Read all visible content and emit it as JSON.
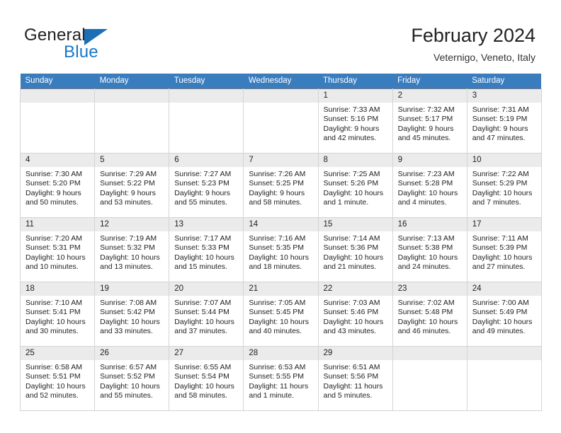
{
  "brand": {
    "name_part1": "General",
    "name_part2": "Blue",
    "accent_color": "#1878c8",
    "triangle_color": "#1c6fb5"
  },
  "header": {
    "title": "February 2024",
    "subtitle": "Veternigo, Veneto, Italy"
  },
  "calendar": {
    "header_bg": "#3a7dbf",
    "daynum_bg": "#ebebeb",
    "weekday_names": [
      "Sunday",
      "Monday",
      "Tuesday",
      "Wednesday",
      "Thursday",
      "Friday",
      "Saturday"
    ],
    "weeks": [
      [
        {
          "day": "",
          "sunrise": "",
          "sunset": "",
          "daylight": ""
        },
        {
          "day": "",
          "sunrise": "",
          "sunset": "",
          "daylight": ""
        },
        {
          "day": "",
          "sunrise": "",
          "sunset": "",
          "daylight": ""
        },
        {
          "day": "",
          "sunrise": "",
          "sunset": "",
          "daylight": ""
        },
        {
          "day": "1",
          "sunrise": "Sunrise: 7:33 AM",
          "sunset": "Sunset: 5:16 PM",
          "daylight": "Daylight: 9 hours and 42 minutes."
        },
        {
          "day": "2",
          "sunrise": "Sunrise: 7:32 AM",
          "sunset": "Sunset: 5:17 PM",
          "daylight": "Daylight: 9 hours and 45 minutes."
        },
        {
          "day": "3",
          "sunrise": "Sunrise: 7:31 AM",
          "sunset": "Sunset: 5:19 PM",
          "daylight": "Daylight: 9 hours and 47 minutes."
        }
      ],
      [
        {
          "day": "4",
          "sunrise": "Sunrise: 7:30 AM",
          "sunset": "Sunset: 5:20 PM",
          "daylight": "Daylight: 9 hours and 50 minutes."
        },
        {
          "day": "5",
          "sunrise": "Sunrise: 7:29 AM",
          "sunset": "Sunset: 5:22 PM",
          "daylight": "Daylight: 9 hours and 53 minutes."
        },
        {
          "day": "6",
          "sunrise": "Sunrise: 7:27 AM",
          "sunset": "Sunset: 5:23 PM",
          "daylight": "Daylight: 9 hours and 55 minutes."
        },
        {
          "day": "7",
          "sunrise": "Sunrise: 7:26 AM",
          "sunset": "Sunset: 5:25 PM",
          "daylight": "Daylight: 9 hours and 58 minutes."
        },
        {
          "day": "8",
          "sunrise": "Sunrise: 7:25 AM",
          "sunset": "Sunset: 5:26 PM",
          "daylight": "Daylight: 10 hours and 1 minute."
        },
        {
          "day": "9",
          "sunrise": "Sunrise: 7:23 AM",
          "sunset": "Sunset: 5:28 PM",
          "daylight": "Daylight: 10 hours and 4 minutes."
        },
        {
          "day": "10",
          "sunrise": "Sunrise: 7:22 AM",
          "sunset": "Sunset: 5:29 PM",
          "daylight": "Daylight: 10 hours and 7 minutes."
        }
      ],
      [
        {
          "day": "11",
          "sunrise": "Sunrise: 7:20 AM",
          "sunset": "Sunset: 5:31 PM",
          "daylight": "Daylight: 10 hours and 10 minutes."
        },
        {
          "day": "12",
          "sunrise": "Sunrise: 7:19 AM",
          "sunset": "Sunset: 5:32 PM",
          "daylight": "Daylight: 10 hours and 13 minutes."
        },
        {
          "day": "13",
          "sunrise": "Sunrise: 7:17 AM",
          "sunset": "Sunset: 5:33 PM",
          "daylight": "Daylight: 10 hours and 15 minutes."
        },
        {
          "day": "14",
          "sunrise": "Sunrise: 7:16 AM",
          "sunset": "Sunset: 5:35 PM",
          "daylight": "Daylight: 10 hours and 18 minutes."
        },
        {
          "day": "15",
          "sunrise": "Sunrise: 7:14 AM",
          "sunset": "Sunset: 5:36 PM",
          "daylight": "Daylight: 10 hours and 21 minutes."
        },
        {
          "day": "16",
          "sunrise": "Sunrise: 7:13 AM",
          "sunset": "Sunset: 5:38 PM",
          "daylight": "Daylight: 10 hours and 24 minutes."
        },
        {
          "day": "17",
          "sunrise": "Sunrise: 7:11 AM",
          "sunset": "Sunset: 5:39 PM",
          "daylight": "Daylight: 10 hours and 27 minutes."
        }
      ],
      [
        {
          "day": "18",
          "sunrise": "Sunrise: 7:10 AM",
          "sunset": "Sunset: 5:41 PM",
          "daylight": "Daylight: 10 hours and 30 minutes."
        },
        {
          "day": "19",
          "sunrise": "Sunrise: 7:08 AM",
          "sunset": "Sunset: 5:42 PM",
          "daylight": "Daylight: 10 hours and 33 minutes."
        },
        {
          "day": "20",
          "sunrise": "Sunrise: 7:07 AM",
          "sunset": "Sunset: 5:44 PM",
          "daylight": "Daylight: 10 hours and 37 minutes."
        },
        {
          "day": "21",
          "sunrise": "Sunrise: 7:05 AM",
          "sunset": "Sunset: 5:45 PM",
          "daylight": "Daylight: 10 hours and 40 minutes."
        },
        {
          "day": "22",
          "sunrise": "Sunrise: 7:03 AM",
          "sunset": "Sunset: 5:46 PM",
          "daylight": "Daylight: 10 hours and 43 minutes."
        },
        {
          "day": "23",
          "sunrise": "Sunrise: 7:02 AM",
          "sunset": "Sunset: 5:48 PM",
          "daylight": "Daylight: 10 hours and 46 minutes."
        },
        {
          "day": "24",
          "sunrise": "Sunrise: 7:00 AM",
          "sunset": "Sunset: 5:49 PM",
          "daylight": "Daylight: 10 hours and 49 minutes."
        }
      ],
      [
        {
          "day": "25",
          "sunrise": "Sunrise: 6:58 AM",
          "sunset": "Sunset: 5:51 PM",
          "daylight": "Daylight: 10 hours and 52 minutes."
        },
        {
          "day": "26",
          "sunrise": "Sunrise: 6:57 AM",
          "sunset": "Sunset: 5:52 PM",
          "daylight": "Daylight: 10 hours and 55 minutes."
        },
        {
          "day": "27",
          "sunrise": "Sunrise: 6:55 AM",
          "sunset": "Sunset: 5:54 PM",
          "daylight": "Daylight: 10 hours and 58 minutes."
        },
        {
          "day": "28",
          "sunrise": "Sunrise: 6:53 AM",
          "sunset": "Sunset: 5:55 PM",
          "daylight": "Daylight: 11 hours and 1 minute."
        },
        {
          "day": "29",
          "sunrise": "Sunrise: 6:51 AM",
          "sunset": "Sunset: 5:56 PM",
          "daylight": "Daylight: 11 hours and 5 minutes."
        },
        {
          "day": "",
          "sunrise": "",
          "sunset": "",
          "daylight": ""
        },
        {
          "day": "",
          "sunrise": "",
          "sunset": "",
          "daylight": ""
        }
      ]
    ]
  }
}
